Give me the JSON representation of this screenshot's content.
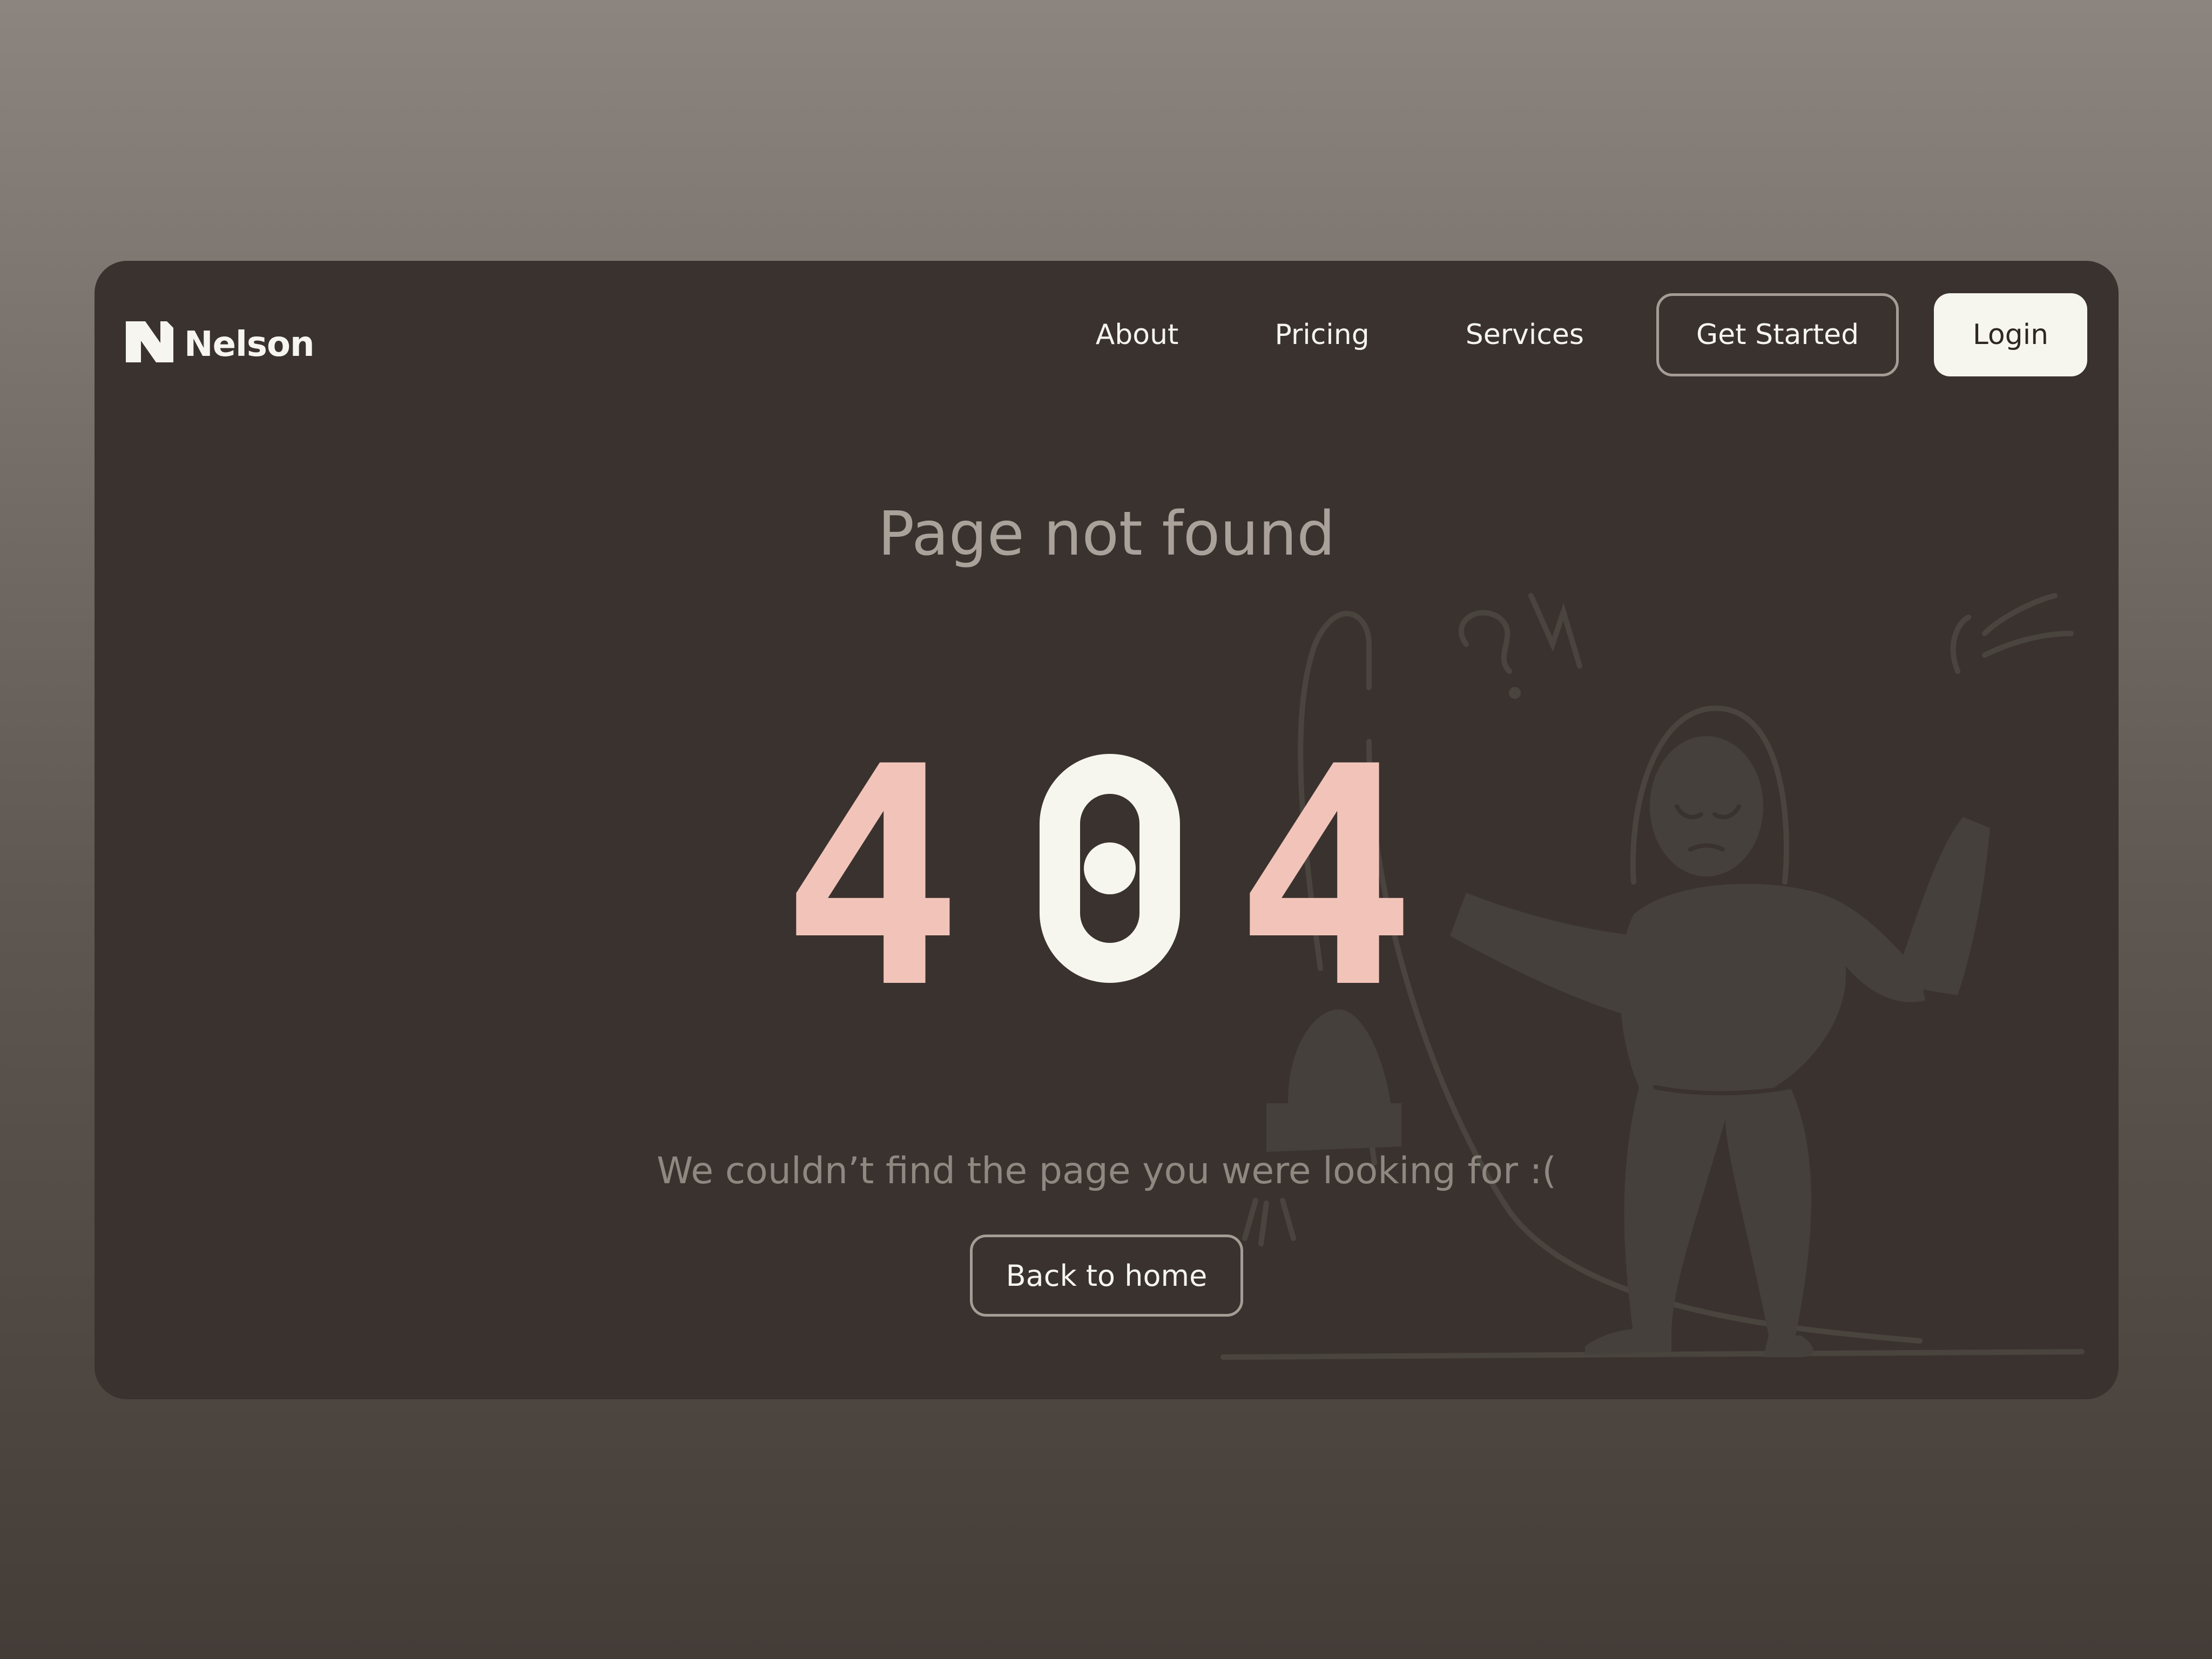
{
  "brand": {
    "name": "Nelson",
    "logo_icon": "n-logo-icon"
  },
  "nav": {
    "links": [
      "About",
      "Pricing",
      "Services"
    ],
    "get_started_label": "Get Started",
    "login_label": "Login"
  },
  "error": {
    "title": "Page not found",
    "code_digits": [
      "4",
      "0",
      "4"
    ],
    "message": "We couldn’t find the page you were looking for :(",
    "back_label": "Back to home"
  },
  "illustration": {
    "icon": "confused-person-with-unplugged-cable-illustration"
  },
  "colors": {
    "page_bg": "#6e6660",
    "card_bg": "#3a322e",
    "accent_pink": "#f2c4b9",
    "off_white": "#f7f6ee",
    "muted_text": "#aaa19a",
    "figure": "#45403b"
  }
}
